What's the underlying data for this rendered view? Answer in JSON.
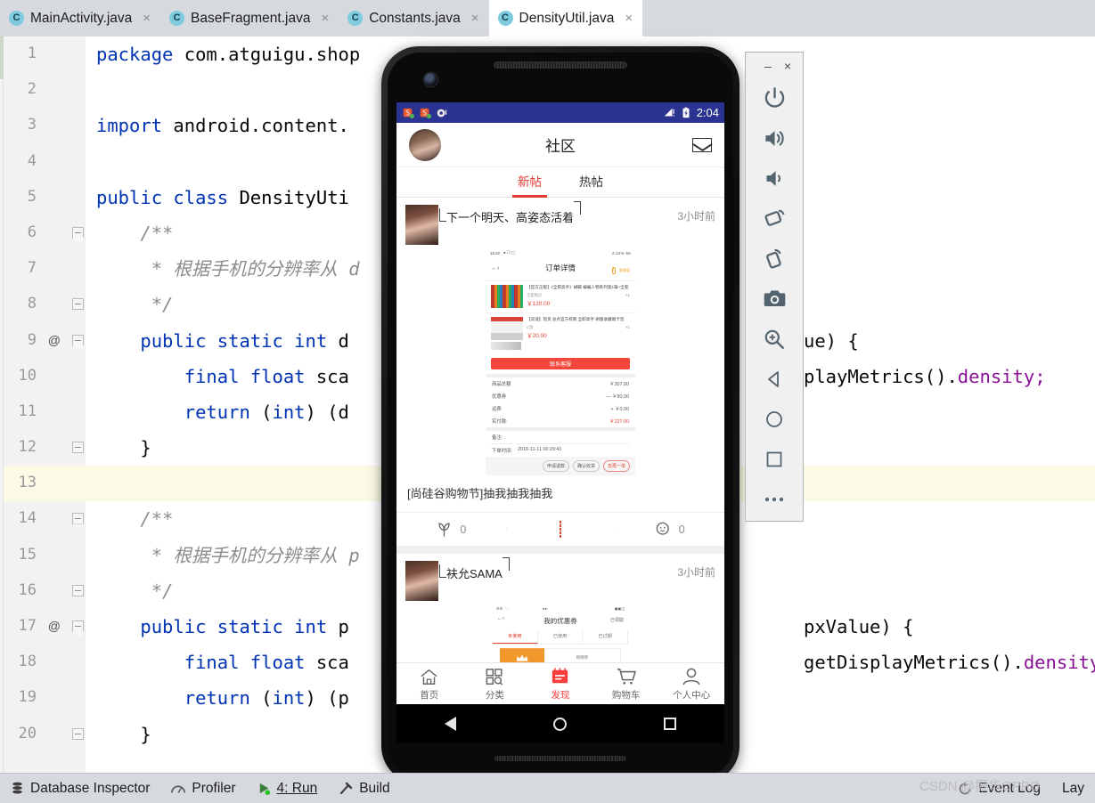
{
  "ide": {
    "tabs": [
      {
        "label": "MainActivity.java",
        "icon": "java-class-icon",
        "active": false,
        "close": "×"
      },
      {
        "label": "BaseFragment.java",
        "icon": "java-class-icon",
        "active": false,
        "close": "×"
      },
      {
        "label": "Constants.java",
        "icon": "java-class-icon",
        "active": false,
        "close": "×"
      },
      {
        "label": "DensityUtil.java",
        "icon": "java-class-icon",
        "active": true,
        "close": "×"
      }
    ],
    "tab_icon_letter": "C",
    "editor": {
      "highlighted_line": 13,
      "lines": [
        {
          "n": "1",
          "at": "",
          "fold": "none",
          "tokens": [
            {
              "t": "package",
              "c": "kw"
            },
            {
              "t": " com.atguigu.shop",
              "c": "plain"
            }
          ]
        },
        {
          "n": "2",
          "at": "",
          "fold": "none",
          "tokens": []
        },
        {
          "n": "3",
          "at": "",
          "fold": "none",
          "tokens": [
            {
              "t": "import",
              "c": "kw"
            },
            {
              "t": " android.content.",
              "c": "plain"
            }
          ]
        },
        {
          "n": "4",
          "at": "",
          "fold": "none",
          "tokens": []
        },
        {
          "n": "5",
          "at": "",
          "fold": "none",
          "tokens": [
            {
              "t": "public class",
              "c": "kw"
            },
            {
              "t": " DensityUti",
              "c": "cls"
            }
          ]
        },
        {
          "n": "6",
          "at": "",
          "fold": "arrow",
          "tokens": [
            {
              "t": "    /**",
              "c": "cmt"
            }
          ]
        },
        {
          "n": "7",
          "at": "",
          "fold": "none",
          "tokens": [
            {
              "t": "     * 根据手机的分辨率从 d",
              "c": "cmt"
            }
          ]
        },
        {
          "n": "8",
          "at": "",
          "fold": "plain",
          "tokens": [
            {
              "t": "     */",
              "c": "cmt"
            }
          ]
        },
        {
          "n": "9",
          "at": "@",
          "fold": "arrow",
          "tokens": [
            {
              "t": "    public static int",
              "c": "kw"
            },
            {
              "t": " d",
              "c": "plain"
            }
          ]
        },
        {
          "n": "10",
          "at": "",
          "fold": "none",
          "tokens": [
            {
              "t": "        final float",
              "c": "kw"
            },
            {
              "t": " sca",
              "c": "plain"
            }
          ]
        },
        {
          "n": "11",
          "at": "",
          "fold": "none",
          "tokens": [
            {
              "t": "        return",
              "c": "kw"
            },
            {
              "t": " (",
              "c": "plain"
            },
            {
              "t": "int",
              "c": "kw"
            },
            {
              "t": ") (d",
              "c": "plain"
            }
          ]
        },
        {
          "n": "12",
          "at": "",
          "fold": "plain",
          "tokens": [
            {
              "t": "    }",
              "c": "plain"
            }
          ]
        },
        {
          "n": "13",
          "at": "",
          "fold": "none",
          "tokens": []
        },
        {
          "n": "14",
          "at": "",
          "fold": "arrow",
          "tokens": [
            {
              "t": "    /**",
              "c": "cmt"
            }
          ]
        },
        {
          "n": "15",
          "at": "",
          "fold": "none",
          "tokens": [
            {
              "t": "     * 根据手机的分辨率从 p",
              "c": "cmt"
            }
          ]
        },
        {
          "n": "16",
          "at": "",
          "fold": "plain",
          "tokens": [
            {
              "t": "     */",
              "c": "cmt"
            }
          ]
        },
        {
          "n": "17",
          "at": "@",
          "fold": "arrow",
          "tokens": [
            {
              "t": "    public static int",
              "c": "kw"
            },
            {
              "t": " p",
              "c": "plain"
            }
          ]
        },
        {
          "n": "18",
          "at": "",
          "fold": "none",
          "tokens": [
            {
              "t": "        final float",
              "c": "kw"
            },
            {
              "t": " sca",
              "c": "plain"
            }
          ]
        },
        {
          "n": "19",
          "at": "",
          "fold": "none",
          "tokens": [
            {
              "t": "        return",
              "c": "kw"
            },
            {
              "t": " (",
              "c": "plain"
            },
            {
              "t": "int",
              "c": "kw"
            },
            {
              "t": ") (p",
              "c": "plain"
            }
          ]
        },
        {
          "n": "20",
          "at": "",
          "fold": "plain",
          "tokens": [
            {
              "t": "    }",
              "c": "plain"
            }
          ]
        }
      ],
      "right_fragments": [
        {
          "line": 9,
          "text_plain": "ue) {",
          "text_field": ""
        },
        {
          "line": 10,
          "text_plain": "playMetrics().",
          "text_field": "density;"
        },
        {
          "line": 17,
          "text_plain": "pxValue) {",
          "text_field": ""
        },
        {
          "line": 18,
          "text_plain": "getDisplayMetrics().",
          "text_field": "density;"
        }
      ]
    },
    "statusbar": {
      "items": [
        {
          "label": "Database Inspector",
          "icon": "database-icon"
        },
        {
          "label": "Profiler",
          "icon": "profiler-icon"
        },
        {
          "label": "4: Run",
          "icon": "run-icon"
        },
        {
          "label": "Build",
          "icon": "build-hammer-icon"
        }
      ],
      "right_items": [
        {
          "label": "Event Log",
          "icon": "event-log-icon"
        },
        {
          "label": "Lay",
          "icon": ""
        }
      ],
      "watermark": "CSDN @振华OPPO"
    }
  },
  "emulator": {
    "window_controls": {
      "minimize": "–",
      "close": "×"
    },
    "toolbar_buttons": [
      {
        "name": "power-icon",
        "title": "Power"
      },
      {
        "name": "volume-up-icon",
        "title": "Volume Up"
      },
      {
        "name": "volume-down-icon",
        "title": "Volume Down"
      },
      {
        "name": "rotate-left-icon",
        "title": "Rotate Left"
      },
      {
        "name": "rotate-right-icon",
        "title": "Rotate Right"
      },
      {
        "name": "camera-icon",
        "title": "Take Screenshot"
      },
      {
        "name": "zoom-icon",
        "title": "Zoom Mode"
      },
      {
        "name": "back-icon",
        "title": "Back"
      },
      {
        "name": "home-icon",
        "title": "Home"
      },
      {
        "name": "overview-icon",
        "title": "Overview"
      },
      {
        "name": "more-icon",
        "title": "More"
      }
    ],
    "device": {
      "status_bar": {
        "time": "2:04",
        "signal": "signal-icon",
        "battery": "battery-icon",
        "notif_icons": [
          "app-notif-1",
          "app-notif-2",
          "app-notif-3"
        ]
      },
      "app": {
        "title": "社区",
        "mail_icon": "mail-icon",
        "avatar": "user-avatar",
        "tabs": [
          {
            "label": "新帖",
            "selected": true
          },
          {
            "label": "热帖",
            "selected": false
          }
        ],
        "posts": [
          {
            "author": "下一个明天、高姿态活着",
            "time": "3小时前",
            "text": "[尚硅谷购物节]抽我抽我抽我",
            "like_count": "0",
            "comment_count": "0",
            "attachment": {
              "type": "order-detail-screenshot",
              "status_time": "15:22",
              "status_right": "2.22% 56",
              "title": "订单详情",
              "kefu_label": "客服管",
              "items": [
                {
                  "title": "【官方正版】《全职高手》蝴蝶 蝙蝙人物系列第1辑~全套",
                  "sub": "全套购买",
                  "qty": "×1",
                  "price": "￥120.00"
                },
                {
                  "title": "【双速】现货 总点官方校教 全职高手 刷版收藏端卡签",
                  "sub": "C款",
                  "qty": "×1",
                  "price": "￥20.00"
                }
              ],
              "contact_btn": "联系客服",
              "rows": [
                {
                  "label": "商品总额",
                  "value": "￥307.00",
                  "red": false
                },
                {
                  "label": "优惠券",
                  "value": "— ￥80.00",
                  "red": false
                },
                {
                  "label": "运费",
                  "value": "+ ￥0.00",
                  "red": false
                },
                {
                  "label": "实付款:",
                  "value": "￥227.00",
                  "red": true
                }
              ],
              "note_label": "备注:",
              "order_time_label": "下单时间:",
              "order_time_value": "2016-11-11 00:29:41",
              "buttons": [
                {
                  "label": "申请退款",
                  "red": false
                },
                {
                  "label": "确认收货",
                  "red": false
                },
                {
                  "label": "去再一单",
                  "red": true
                }
              ]
            }
          },
          {
            "author": "衭允SAMA",
            "time": "3小时前",
            "attachment": {
              "type": "coupon-screenshot",
              "title": "我的优惠券",
              "right_label": "已领取",
              "tabs": [
                {
                  "label": "未使用",
                  "selected": true
                },
                {
                  "label": "已使用",
                  "selected": false
                },
                {
                  "label": "已过期",
                  "selected": false
                }
              ],
              "card_label": "购物券"
            }
          }
        ],
        "bottom_nav": [
          {
            "label": "首页",
            "icon": "home-icon",
            "selected": false
          },
          {
            "label": "分类",
            "icon": "grid-icon",
            "selected": false
          },
          {
            "label": "发现",
            "icon": "discover-icon",
            "selected": true
          },
          {
            "label": "购物车",
            "icon": "cart-icon",
            "selected": false
          },
          {
            "label": "个人中心",
            "icon": "person-icon",
            "selected": false
          }
        ]
      },
      "nav_bar": [
        {
          "name": "android-back-icon"
        },
        {
          "name": "android-home-icon"
        },
        {
          "name": "android-recents-icon"
        }
      ]
    }
  },
  "colors": {
    "tab_bar_bg": "#d6d9de",
    "status_bar_blue": "#2b3390",
    "accent_red": "#e2412f",
    "keyword_blue": "#0033b3",
    "field_purple": "#871094",
    "comment_gray": "#8c8c8c",
    "highlight_line": "#fcfae6"
  }
}
